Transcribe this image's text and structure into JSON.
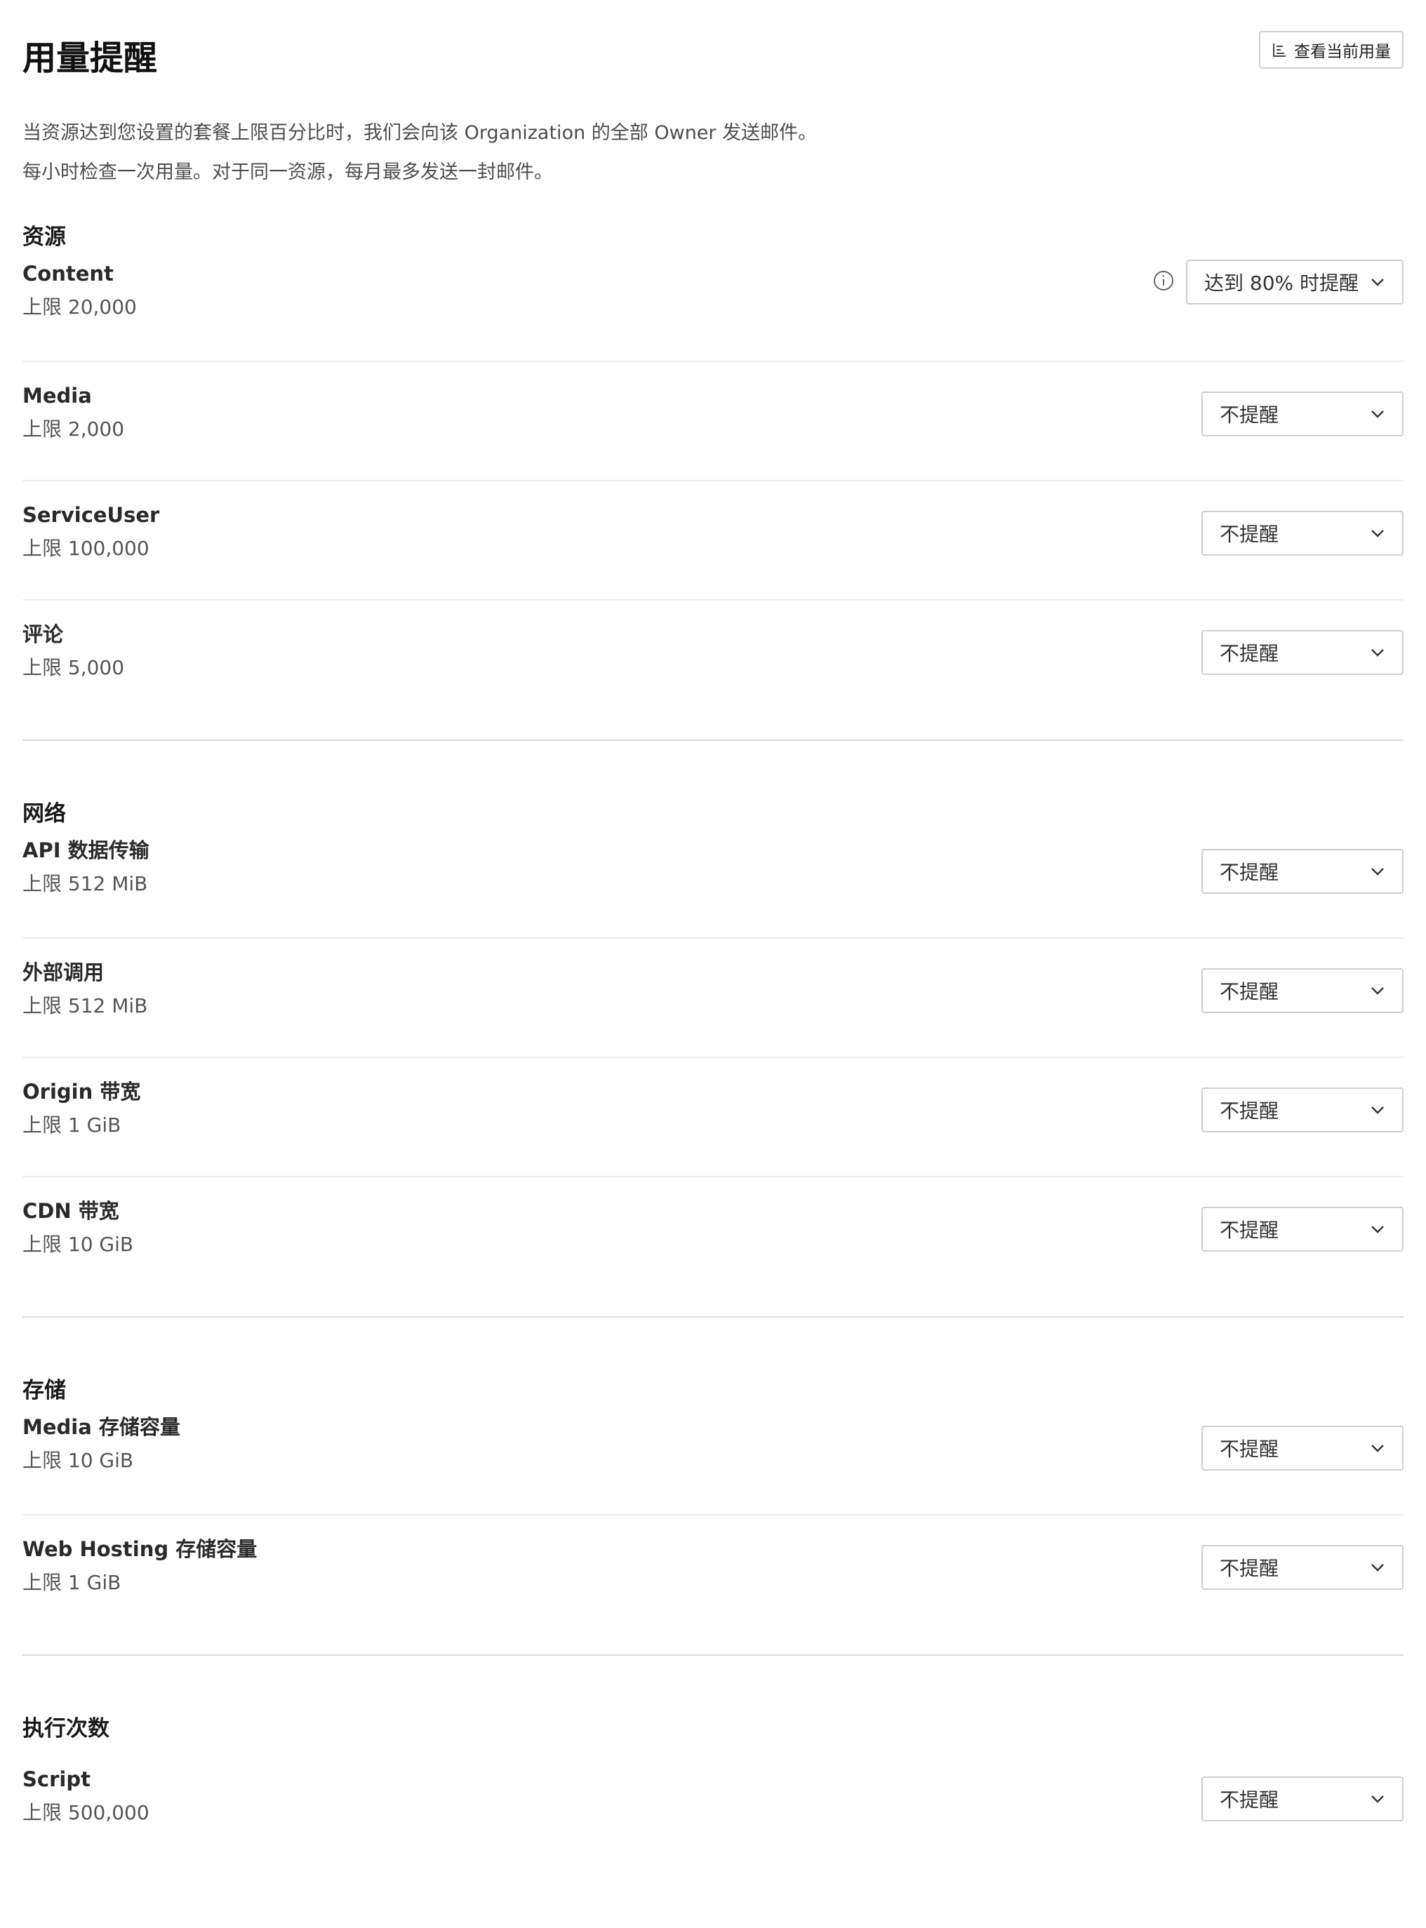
{
  "header": {
    "title": "用量提醒",
    "view_usage_label": "查看当前用量"
  },
  "description": {
    "line1": "当资源达到您设置的套餐上限百分比时，我们会向该 Organization 的全部 Owner 发送邮件。",
    "line2": "每小时检查一次用量。对于同一资源，每月最多发送一封邮件。"
  },
  "sections": [
    {
      "title": "资源",
      "rows": [
        {
          "name": "Content",
          "limit": "上限 20,000",
          "alert": "达到 80% 时提醒"
        },
        {
          "name": "Media",
          "limit": "上限 2,000",
          "alert": "不提醒"
        },
        {
          "name": "ServiceUser",
          "limit": "上限 100,000",
          "alert": "不提醒"
        },
        {
          "name": "评论",
          "limit": "上限 5,000",
          "alert": "不提醒"
        }
      ]
    },
    {
      "title": "网络",
      "rows": [
        {
          "name": "API 数据传输",
          "limit": "上限 512 MiB",
          "alert": "不提醒"
        },
        {
          "name": "外部调用",
          "limit": "上限 512 MiB",
          "alert": "不提醒"
        },
        {
          "name": "Origin 带宽",
          "limit": "上限 1 GiB",
          "alert": "不提醒"
        },
        {
          "name": "CDN 带宽",
          "limit": "上限 10 GiB",
          "alert": "不提醒"
        }
      ]
    },
    {
      "title": "存储",
      "rows": [
        {
          "name": "Media 存储容量",
          "limit": "上限 10 GiB",
          "alert": "不提醒"
        },
        {
          "name": "Web Hosting 存储容量",
          "limit": "上限 1 GiB",
          "alert": "不提醒"
        }
      ]
    },
    {
      "title": "执行次数",
      "rows": [
        {
          "name": "Script",
          "limit": "上限 500,000",
          "alert": "不提醒"
        }
      ]
    }
  ],
  "colors": {
    "border": "#cfcfcf",
    "divider": "#d9d9d9",
    "row_separator": "#eeeeee",
    "muted_text": "#555555"
  }
}
